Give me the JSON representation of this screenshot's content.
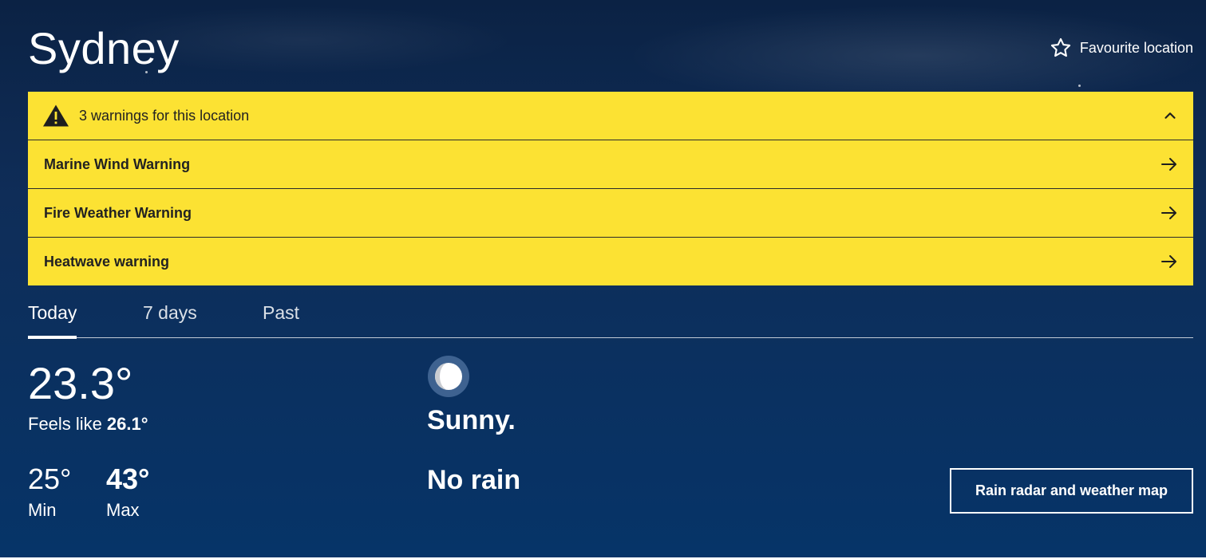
{
  "location": {
    "title": "Sydney",
    "favourite_label": "Favourite location"
  },
  "warnings": {
    "summary": "3 warnings for this location",
    "items": [
      {
        "label": "Marine Wind Warning"
      },
      {
        "label": "Fire Weather Warning"
      },
      {
        "label": "Heatwave warning"
      }
    ]
  },
  "tabs": [
    {
      "label": "Today",
      "active": true
    },
    {
      "label": "7 days",
      "active": false
    },
    {
      "label": "Past",
      "active": false
    }
  ],
  "current": {
    "temperature": "23.3°",
    "feels_like_label": "Feels like",
    "feels_like_value": "26.1°",
    "min_value": "25°",
    "min_label": "Min",
    "max_value": "43°",
    "max_label": "Max",
    "condition_icon": "moon-icon",
    "condition": "Sunny.",
    "rain": "No rain"
  },
  "actions": {
    "radar_button": "Rain radar and weather map"
  },
  "colors": {
    "warning_background": "#fce233",
    "hero_background": "#0f2d58",
    "text": "#ffffff"
  }
}
